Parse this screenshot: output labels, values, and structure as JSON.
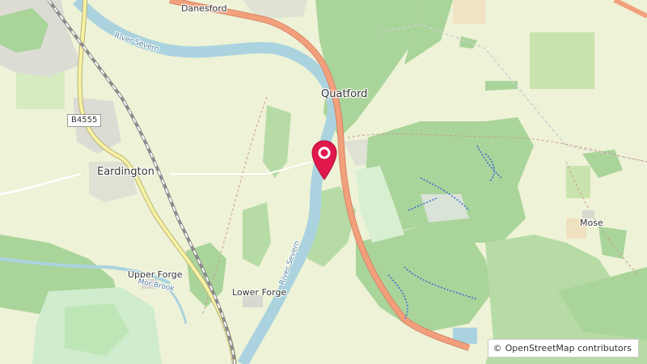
{
  "map": {
    "places": {
      "danesford": "Danesford",
      "quatford": "Quatford",
      "eardington": "Eardington",
      "mose": "Mose",
      "upper_forge": "Upper Forge",
      "lower_forge": "Lower Forge"
    },
    "waterways": {
      "river_severn_north": "River Severn",
      "river_severn_south": "River Severn",
      "mor_brook": "Mor Brook"
    },
    "roads": {
      "b4555": "B4555"
    },
    "attribution": {
      "symbol": "©",
      "text": "OpenStreetMap contributors"
    },
    "marker": {
      "icon": "map-pin-icon",
      "color": "#e0184c"
    },
    "colors": {
      "land": "#eef2d6",
      "forest": "#a9d49a",
      "water": "#aad3df",
      "road_primary": "#f2a07b",
      "road_secondary": "#f7f1a3",
      "railway": "#8a8a8a"
    }
  }
}
